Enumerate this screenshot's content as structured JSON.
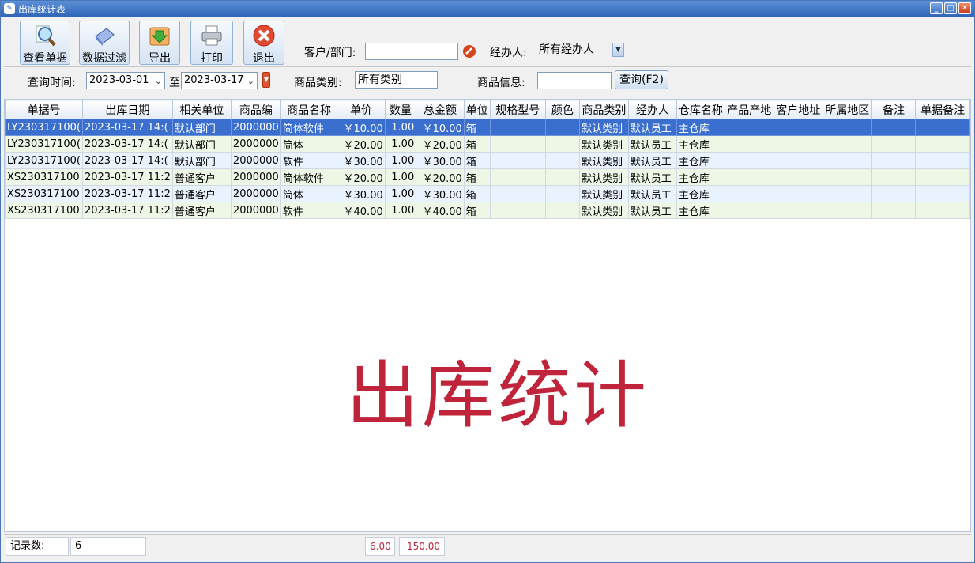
{
  "window": {
    "title": "出库统计表",
    "app_icon": "app-logo-icon"
  },
  "toolbar": {
    "buttons": [
      {
        "label": "查看单据",
        "icon": "magnifier-doc-icon"
      },
      {
        "label": "数据过滤",
        "icon": "book-filter-icon"
      },
      {
        "label": "导出",
        "icon": "export-arrow-icon"
      },
      {
        "label": "打印",
        "icon": "printer-icon"
      },
      {
        "label": "退出",
        "icon": "exit-x-icon"
      }
    ],
    "customer_label": "客户/部门:",
    "customer_value": "",
    "handler_label": "经办人:",
    "handler_value": "所有经办人"
  },
  "filters": {
    "time_label": "查询时间:",
    "date_from": "2023-03-01",
    "to_label": "至",
    "date_to": "2023-03-17",
    "category_label": "商品类别:",
    "category_value": "所有类别",
    "info_label": "商品信息:",
    "info_value": "",
    "query_button": "查询(F2)"
  },
  "table": {
    "columns": [
      "单据号",
      "出库日期",
      "相关单位",
      "商品编",
      "商品名称",
      "单价",
      "数量",
      "总金额",
      "单位",
      "规格型号",
      "颜色",
      "商品类别",
      "经办人",
      "仓库名称",
      "产品产地",
      "客户地址",
      "所属地区",
      "备注",
      "单据备注"
    ],
    "rows": [
      [
        "LY230317100(",
        "2023-03-17 14:(",
        "默认部门",
        "2000000",
        "简体软件",
        "￥10.00",
        "1.00",
        "￥10.00",
        "箱",
        "",
        "",
        "默认类别",
        "默认员工",
        "主仓库",
        "",
        "",
        "",
        "",
        ""
      ],
      [
        "LY230317100(",
        "2023-03-17 14:(",
        "默认部门",
        "2000000",
        "简体",
        "￥20.00",
        "1.00",
        "￥20.00",
        "箱",
        "",
        "",
        "默认类别",
        "默认员工",
        "主仓库",
        "",
        "",
        "",
        "",
        ""
      ],
      [
        "LY230317100(",
        "2023-03-17 14:(",
        "默认部门",
        "2000000",
        "软件",
        "￥30.00",
        "1.00",
        "￥30.00",
        "箱",
        "",
        "",
        "默认类别",
        "默认员工",
        "主仓库",
        "",
        "",
        "",
        "",
        ""
      ],
      [
        "XS230317100",
        "2023-03-17 11:2",
        "普通客户",
        "2000000",
        "简体软件",
        "￥20.00",
        "1.00",
        "￥20.00",
        "箱",
        "",
        "",
        "默认类别",
        "默认员工",
        "主仓库",
        "",
        "",
        "",
        "",
        ""
      ],
      [
        "XS230317100",
        "2023-03-17 11:2",
        "普通客户",
        "2000000",
        "简体",
        "￥30.00",
        "1.00",
        "￥30.00",
        "箱",
        "",
        "",
        "默认类别",
        "默认员工",
        "主仓库",
        "",
        "",
        "",
        "",
        ""
      ],
      [
        "XS230317100",
        "2023-03-17 11:2",
        "普通客户",
        "2000000",
        "软件",
        "￥40.00",
        "1.00",
        "￥40.00",
        "箱",
        "",
        "",
        "默认类别",
        "默认员工",
        "主仓库",
        "",
        "",
        "",
        "",
        ""
      ]
    ]
  },
  "watermark": "出库统计",
  "status": {
    "record_label": "记录数:",
    "record_count": "6",
    "total_qty": "6.00",
    "total_amount": "150.00"
  },
  "colors": {
    "selected_row": "#3a6fd0",
    "accent_red": "#c0243a",
    "title_bar": "#2f66b8"
  }
}
